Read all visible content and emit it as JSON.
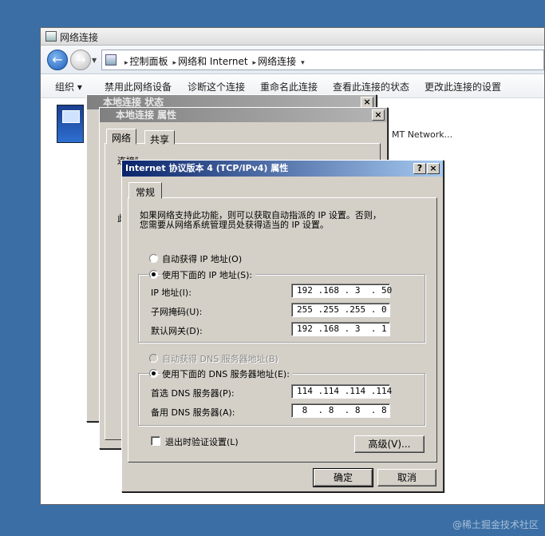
{
  "explorer": {
    "title": "网络连接",
    "address": {
      "crumb1": "控制面板",
      "crumb2": "网络和 Internet",
      "crumb3": "网络连接"
    },
    "commands": {
      "organize": "组织 ▾",
      "disable": "禁用此网络设备",
      "diagnose": "诊断这个连接",
      "rename": "重命名此连接",
      "view_status": "查看此连接的状态",
      "change_settings": "更改此连接的设置"
    },
    "content_text": "MT Network..."
  },
  "status_dialog": {
    "title": "本地连接 状态",
    "close": "×"
  },
  "props_dialog": {
    "title": "本地连接 属性",
    "close": "×",
    "tabs": {
      "network": "网络",
      "sharing": "共享"
    },
    "connect_using": "连接时使用:",
    "partial_label": "此"
  },
  "tcp_dialog": {
    "title": "Internet 协议版本 4 (TCP/IPv4) 属性",
    "help": "?",
    "close": "×",
    "tab_general": "常规",
    "description_line1": "如果网络支持此功能，则可以获取自动指派的 IP 设置。否则，",
    "description_line2": "您需要从网络系统管理员处获得适当的 IP 设置。",
    "auto_ip": "自动获得 IP 地址(O)",
    "use_ip": "使用下面的 IP 地址(S):",
    "ip_label": "IP 地址(I):",
    "ip_value": "192 .168 . 3  . 50",
    "mask_label": "子网掩码(U):",
    "mask_value": "255 .255 .255 . 0",
    "gateway_label": "默认网关(D):",
    "gateway_value": "192 .168 . 3  . 1",
    "auto_dns": "自动获得 DNS 服务器地址(B)",
    "use_dns": "使用下面的 DNS 服务器地址(E):",
    "pref_dns_label": "首选 DNS 服务器(P):",
    "pref_dns_value": "114 .114 .114 .114",
    "alt_dns_label": "备用 DNS 服务器(A):",
    "alt_dns_value": " 8  . 8  . 8  . 8",
    "validate_on_exit": "退出时验证设置(L)",
    "advanced": "高级(V)...",
    "ok": "确定",
    "cancel": "取消"
  },
  "watermark": "@稀土掘金技术社区"
}
